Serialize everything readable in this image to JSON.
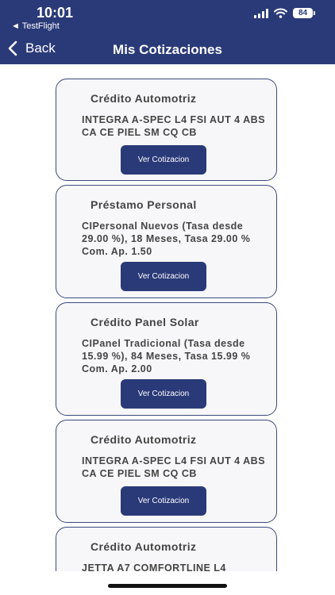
{
  "status": {
    "time": "10:01",
    "back_app": "◄ TestFlight",
    "battery": "84"
  },
  "nav": {
    "back_label": "Back",
    "title": "Mis Cotizaciones"
  },
  "cards": [
    {
      "title": "Crédito Automotriz",
      "description": "INTEGRA A-SPEC L4 FSI AUT 4 ABS CA CE PIEL SM CQ CB",
      "button": "Ver Cotizacion"
    },
    {
      "title": "Préstamo Personal",
      "description": "CIPersonal Nuevos (Tasa desde 29.00 %), 18 Meses, Tasa 29.00 % Com. Ap. 1.50",
      "button": "Ver Cotizacion"
    },
    {
      "title": "Crédito Panel Solar",
      "description": "CIPanel Tradicional (Tasa desde 15.99 %), 84 Meses, Tasa 15.99 % Com. Ap. 2.00",
      "button": "Ver Cotizacion"
    },
    {
      "title": "Crédito Automotriz",
      "description": "INTEGRA A-SPEC L4 FSI AUT 4 ABS CA CE PIEL SM CQ CB",
      "button": "Ver Cotizacion"
    },
    {
      "title": "Crédito Automotriz",
      "description": "JETTA A7 COMFORTLINE L4",
      "button": ""
    }
  ]
}
